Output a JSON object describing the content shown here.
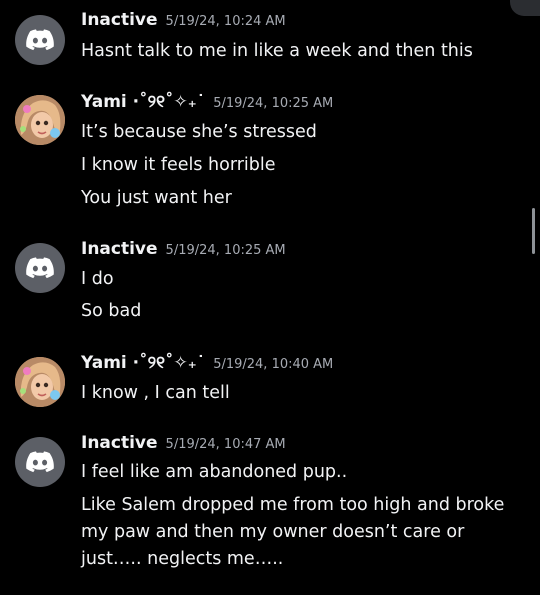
{
  "messages": [
    {
      "username": "Inactive",
      "timestamp": "5/19/24, 10:24 AM",
      "avatar": "discord-default-icon",
      "lines": [
        "Hasnt talk to me in like a week and then this"
      ]
    },
    {
      "username": "Yami ·˚୨୧˚✧₊˙",
      "timestamp": "5/19/24, 10:25 AM",
      "avatar": "profile-photo",
      "lines": [
        "It’s because she’s stressed",
        "I know it feels horrible",
        "You just want her"
      ]
    },
    {
      "username": "Inactive",
      "timestamp": "5/19/24, 10:25 AM",
      "avatar": "discord-default-icon",
      "lines": [
        "I do",
        "So bad"
      ]
    },
    {
      "username": "Yami ·˚୨୧˚✧₊˙",
      "timestamp": "5/19/24, 10:40 AM",
      "avatar": "profile-photo",
      "lines": [
        "I know , I can tell"
      ]
    },
    {
      "username": "Inactive",
      "timestamp": "5/19/24, 10:47 AM",
      "avatar": "discord-default-icon",
      "lines": [
        "I feel like am abandoned pup..",
        "Like Salem dropped me from too high and broke my paw and then my owner doesn’t care or just….. neglects me….."
      ]
    }
  ],
  "colors": {
    "background": "#000000",
    "text": "#f2f3f5",
    "timestamp": "#a7abb3",
    "default_avatar": "#5c5f66"
  }
}
